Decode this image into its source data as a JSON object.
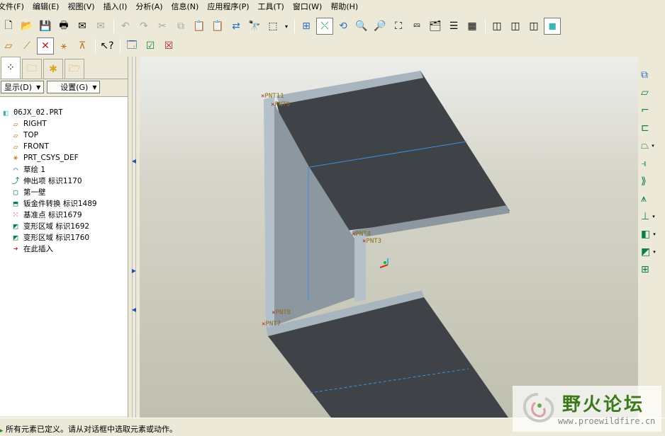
{
  "menu": [
    "文件(F)",
    "编辑(E)",
    "视图(V)",
    "插入(I)",
    "分析(A)",
    "信息(N)",
    "应用程序(P)",
    "工具(T)",
    "窗口(W)",
    "帮助(H)"
  ],
  "panel": {
    "show_label": "显示(D)",
    "settings_label": "设置(G)"
  },
  "tree": {
    "root": "06JX_02.PRT",
    "items": [
      {
        "icon": "datum-plane-icon",
        "label": "RIGHT"
      },
      {
        "icon": "datum-plane-icon",
        "label": "TOP"
      },
      {
        "icon": "datum-plane-icon",
        "label": "FRONT"
      },
      {
        "icon": "csys-icon",
        "label": "PRT_CSYS_DEF"
      },
      {
        "icon": "sketch-icon",
        "label": "草绘 1"
      },
      {
        "icon": "extrude-icon",
        "label": "伸出项 标识1170"
      },
      {
        "icon": "first-wall-icon",
        "label": "第一壁"
      },
      {
        "icon": "sheetmetal-convert-icon",
        "label": "钣金件转换 标识1489"
      },
      {
        "icon": "datum-point-icon",
        "label": "基准点 标识1679"
      },
      {
        "icon": "deform-area-icon",
        "label": "变形区域 标识1692"
      },
      {
        "icon": "deform-area-icon",
        "label": "变形区域 标识1760"
      },
      {
        "icon": "insert-here-icon",
        "label": "在此插入"
      }
    ]
  },
  "viewport": {
    "points": [
      "PNT11",
      "PNT9",
      "PNT4",
      "PNT3",
      "PNT8",
      "PNT7"
    ]
  },
  "status": {
    "message": "所有元素已定义。请从对话框中选取元素或动作。"
  },
  "watermark": {
    "title": "野火论坛",
    "url": "www.proewildfire.cn"
  },
  "colors": {
    "accent_green": "#0b7d4e",
    "sheet_dark": "#3f4348",
    "sheet_side": "#8d979f",
    "edge_blue": "#3a8fe0"
  }
}
